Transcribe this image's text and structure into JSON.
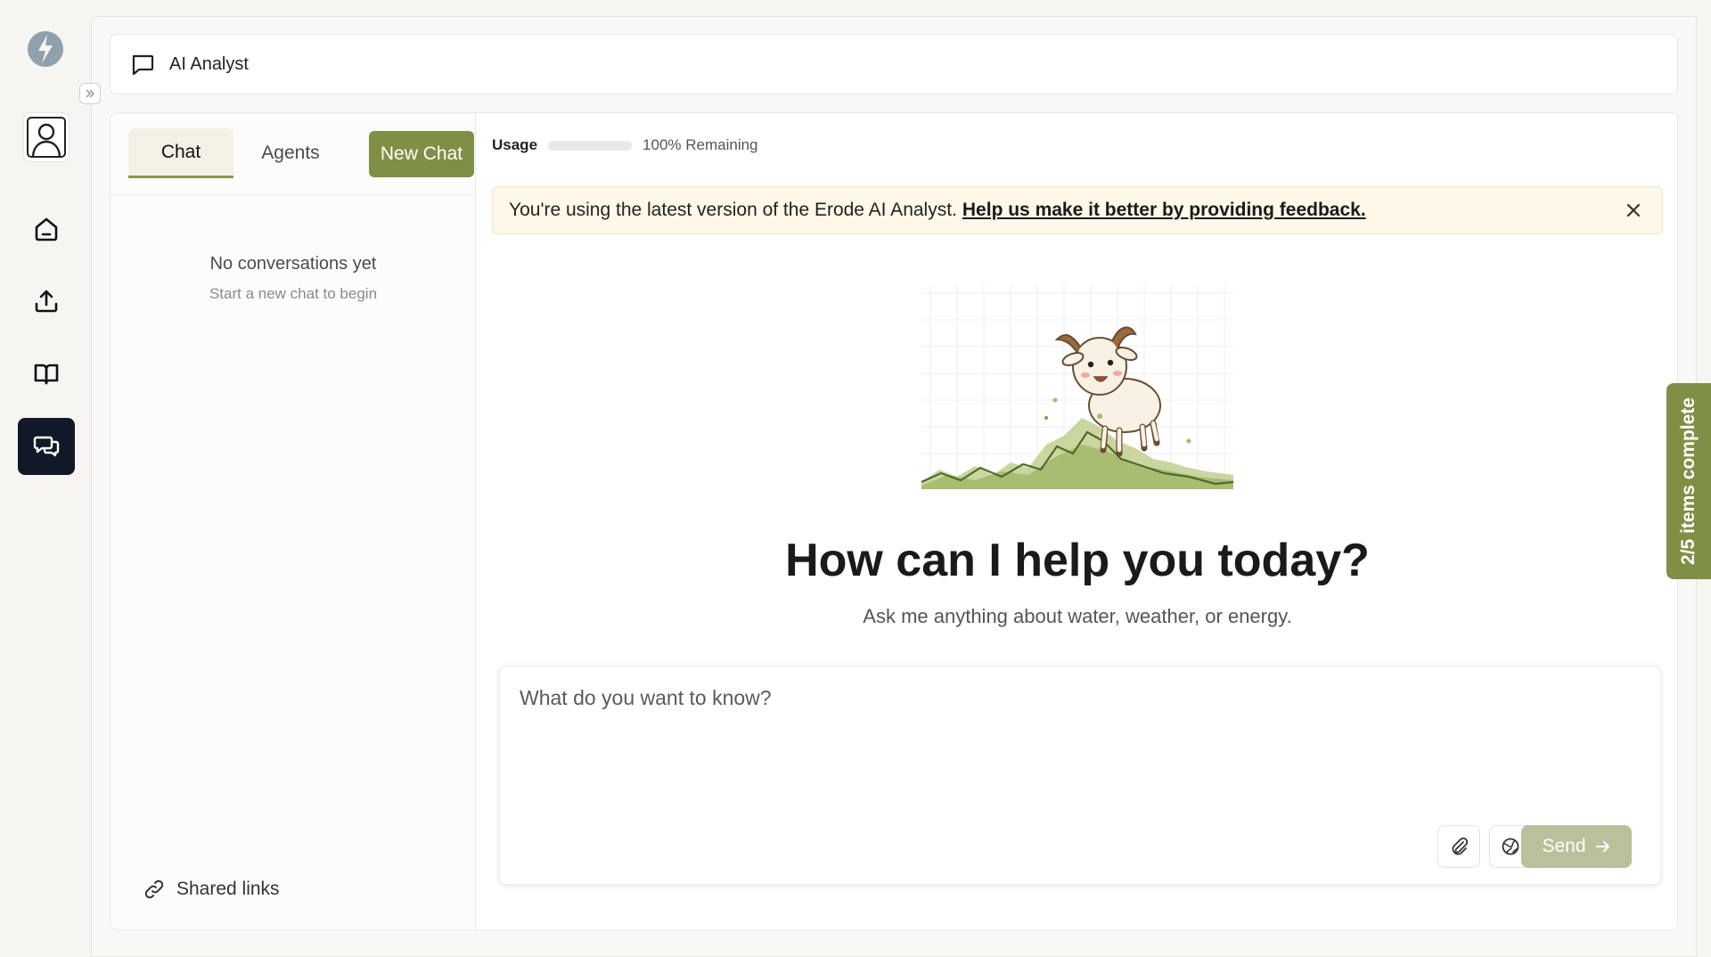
{
  "app": {
    "title": "AI Analyst"
  },
  "sidebar_tabs": {
    "chat": "Chat",
    "agents": "Agents",
    "new_chat": "New Chat"
  },
  "conversations": {
    "empty_title": "No conversations yet",
    "empty_subtitle": "Start a new chat to begin"
  },
  "shared_links": "Shared links",
  "usage": {
    "label": "Usage",
    "remaining": "100% Remaining",
    "used_fraction": 0
  },
  "banner": {
    "text": "You're using the latest version of the Erode AI Analyst.",
    "link": "Help us make it better by providing feedback."
  },
  "hero": {
    "title": "How can I help you today?",
    "subtitle": "Ask me anything about water, weather, or energy."
  },
  "composer": {
    "placeholder": "What do you want to know?",
    "send_label": "Send"
  },
  "progress": {
    "label": "2/5 items complete"
  },
  "colors": {
    "accent": "#7f8f45",
    "send_disabled": "#b8c19a",
    "active_nav": "#111827",
    "banner_bg": "#fdf8e8"
  }
}
